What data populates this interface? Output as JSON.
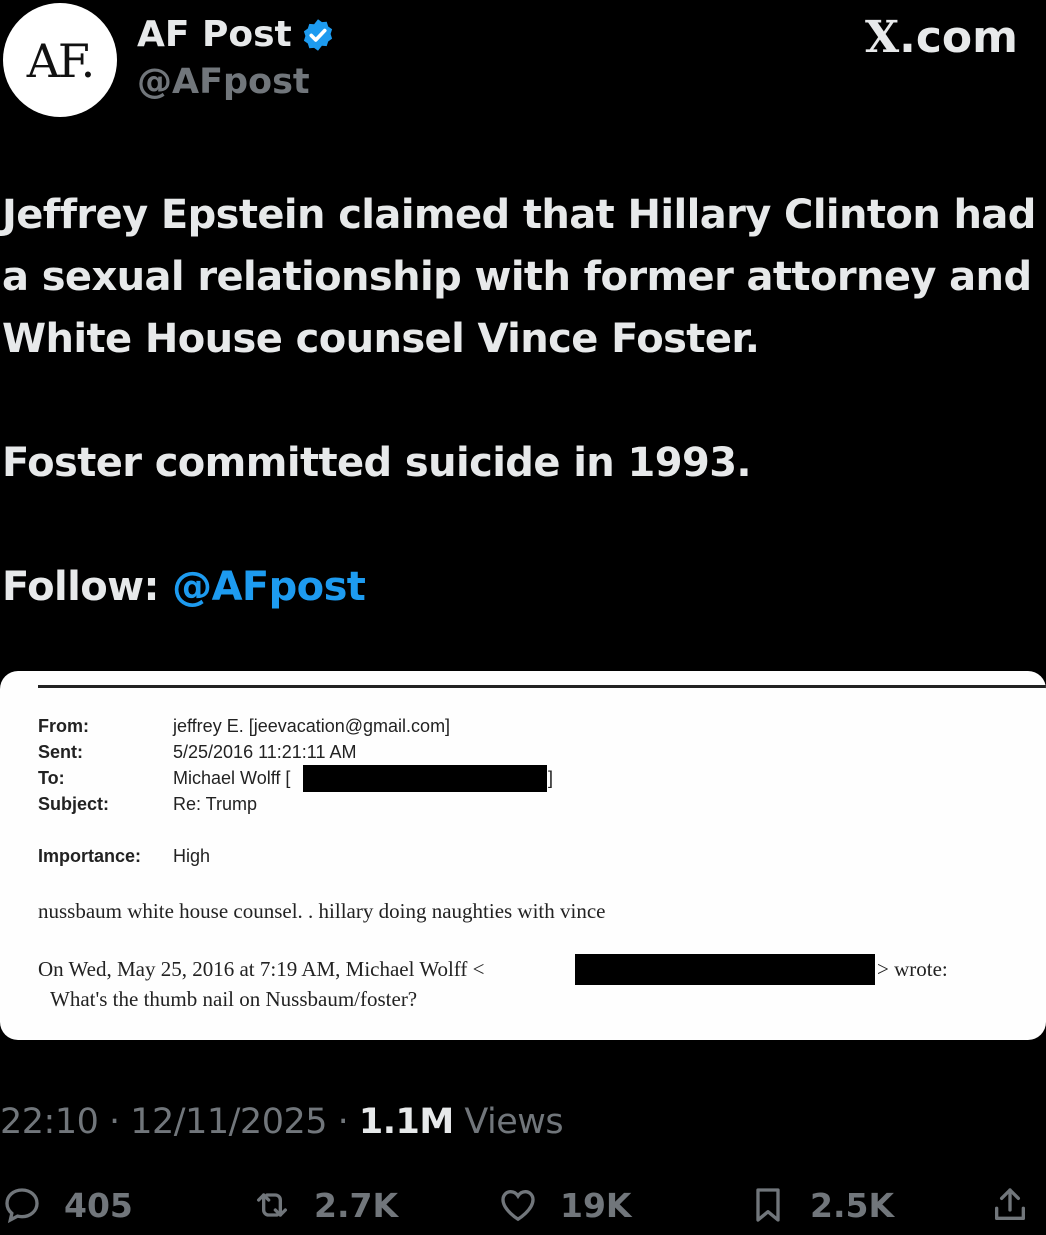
{
  "header": {
    "avatar_text": "AF.",
    "display_name": "AF Post",
    "handle": "@AFpost",
    "site_label_x": "X",
    "site_label_domain": ".com"
  },
  "post": {
    "paragraph_1": "Jeffrey Epstein claimed that Hillary Clinton had a sexual relationship with former attorney and White House counsel Vince Foster.",
    "paragraph_2": "Foster committed suicide in 1993.",
    "follow_label": "Follow:",
    "follow_mention": "@AFpost"
  },
  "email": {
    "from_label": "From:",
    "from_value": "jeffrey E. [jeevacation@gmail.com]",
    "sent_label": "Sent:",
    "sent_value": "5/25/2016 11:21:11 AM",
    "to_label": "To:",
    "to_value": "Michael Wolff [",
    "to_close": "]",
    "subject_label": "Subject:",
    "subject_value": "Re: Trump",
    "importance_label": "Importance:",
    "importance_value": "High",
    "body_line": "nussbaum white house counsel. .   hillary doing naughties with vince",
    "quote_prefix": "On Wed, May 25, 2016 at 7:19 AM, Michael Wolff <",
    "quote_suffix": "> wrote:",
    "quote_text": "What's the thumb nail on Nussbaum/foster?"
  },
  "meta": {
    "time": "22:10",
    "sep1": " · ",
    "date": "12/11/2025",
    "sep2": " · ",
    "views_count": "1.1M",
    "views_label": " Views"
  },
  "actions": {
    "replies": "405",
    "reposts": "2.7K",
    "likes": "19K",
    "bookmarks": "2.5K"
  },
  "colors": {
    "background": "#000000",
    "text": "#e7e9ea",
    "muted": "#71767b",
    "accent": "#1d9bf0"
  },
  "icons": [
    "verified-badge-icon",
    "reply-icon",
    "repost-icon",
    "like-icon",
    "bookmark-icon",
    "share-icon"
  ]
}
